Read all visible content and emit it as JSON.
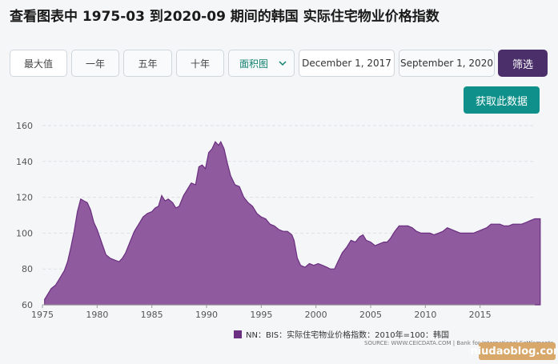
{
  "page": {
    "title": "查看图表中 1975-03 到2020-09 期间的韩国 实际住宅物业价格指数"
  },
  "toolbar": {
    "range_buttons": [
      "最大值",
      "一年",
      "五年",
      "十年"
    ],
    "chart_type": "面积图",
    "start_date": "December 1, 2017",
    "end_date": "September 1, 2020",
    "filter_label": "筛选",
    "fetch_label": "获取此数据"
  },
  "colors": {
    "area_fill": "#8f5a9e",
    "area_stroke": "#6a2f80",
    "filter_button": "#4a2f6b",
    "fetch_button": "#10908a"
  },
  "icons": {
    "dropdown": "chevron-down-icon"
  },
  "legend": {
    "label": "NN：BIS：实际住宅物业价格指数：2010年=100：韩国"
  },
  "source": "SOURCE: WWW.CEICDATA.COM | Bank for International Settlements",
  "watermark": "niudaoblog.com",
  "chart_data": {
    "type": "area",
    "title": "",
    "xlabel": "",
    "ylabel": "",
    "ylim": [
      60,
      160
    ],
    "xlim": [
      1975,
      2020
    ],
    "grid": true,
    "legend_position": "bottom",
    "x_ticks": [
      1975,
      1980,
      1985,
      1990,
      1995,
      2000,
      2005,
      2010,
      2015
    ],
    "y_ticks": [
      60,
      80,
      100,
      120,
      140,
      160
    ],
    "series": [
      {
        "name": "NN：BIS：实际住宅物业价格指数：2010年=100：韩国",
        "x": [
          1975.2,
          1975.5,
          1975.8,
          1976.2,
          1976.6,
          1977.0,
          1977.3,
          1977.6,
          1977.9,
          1978.2,
          1978.5,
          1978.8,
          1979.1,
          1979.4,
          1979.7,
          1980.0,
          1980.4,
          1980.8,
          1981.2,
          1981.6,
          1982.0,
          1982.3,
          1982.6,
          1983.0,
          1983.4,
          1983.8,
          1984.2,
          1984.6,
          1985.0,
          1985.3,
          1985.6,
          1985.9,
          1986.2,
          1986.5,
          1986.9,
          1987.2,
          1987.5,
          1987.9,
          1988.3,
          1988.6,
          1989.0,
          1989.3,
          1989.6,
          1989.9,
          1990.2,
          1990.5,
          1990.8,
          1991.1,
          1991.3,
          1991.6,
          1991.9,
          1992.2,
          1992.6,
          1993.0,
          1993.4,
          1993.8,
          1994.2,
          1994.6,
          1995.0,
          1995.4,
          1995.8,
          1996.2,
          1996.6,
          1997.0,
          1997.4,
          1997.8,
          1998.0,
          1998.3,
          1998.6,
          1999.0,
          1999.4,
          1999.8,
          2000.2,
          2000.6,
          2001.0,
          2001.3,
          2001.7,
          2002.0,
          2002.4,
          2002.8,
          2003.2,
          2003.6,
          2004.0,
          2004.3,
          2004.6,
          2005.0,
          2005.4,
          2005.8,
          2006.2,
          2006.5,
          2006.8,
          2007.2,
          2007.6,
          2008.0,
          2008.4,
          2008.8,
          2009.2,
          2009.6,
          2010.0,
          2010.4,
          2010.8,
          2011.2,
          2011.6,
          2012.0,
          2012.4,
          2012.8,
          2013.2,
          2013.6,
          2014.0,
          2014.4,
          2014.8,
          2015.2,
          2015.6,
          2016.0,
          2016.4,
          2016.8,
          2017.2,
          2017.6,
          2018.0,
          2018.4,
          2018.8,
          2019.2,
          2019.6,
          2020.0,
          2020.5
        ],
        "values": [
          63,
          66,
          69,
          71,
          75,
          79,
          84,
          92,
          101,
          112,
          119,
          118,
          117,
          113,
          106,
          102,
          95,
          88,
          86,
          85,
          84,
          86,
          89,
          95,
          101,
          105,
          109,
          111,
          112,
          114,
          115,
          121,
          118,
          119,
          117,
          114,
          115,
          121,
          125,
          128,
          127,
          137,
          138,
          136,
          145,
          147,
          151,
          149,
          151,
          147,
          139,
          132,
          127,
          126,
          120,
          117,
          115,
          111,
          109,
          108,
          105,
          104,
          102,
          101,
          101,
          99,
          96,
          86,
          82,
          81,
          83,
          82,
          83,
          82,
          81,
          80,
          80,
          84,
          89,
          92,
          96,
          95,
          98,
          99,
          96,
          95,
          93,
          94,
          95,
          95,
          97,
          101,
          104,
          104,
          104,
          103,
          101,
          100,
          100,
          100,
          99,
          100,
          101,
          103,
          102,
          101,
          100,
          100,
          100,
          100,
          101,
          102,
          103,
          105,
          105,
          105,
          104,
          104,
          105,
          105,
          105,
          106,
          107,
          108,
          108
        ]
      }
    ]
  }
}
